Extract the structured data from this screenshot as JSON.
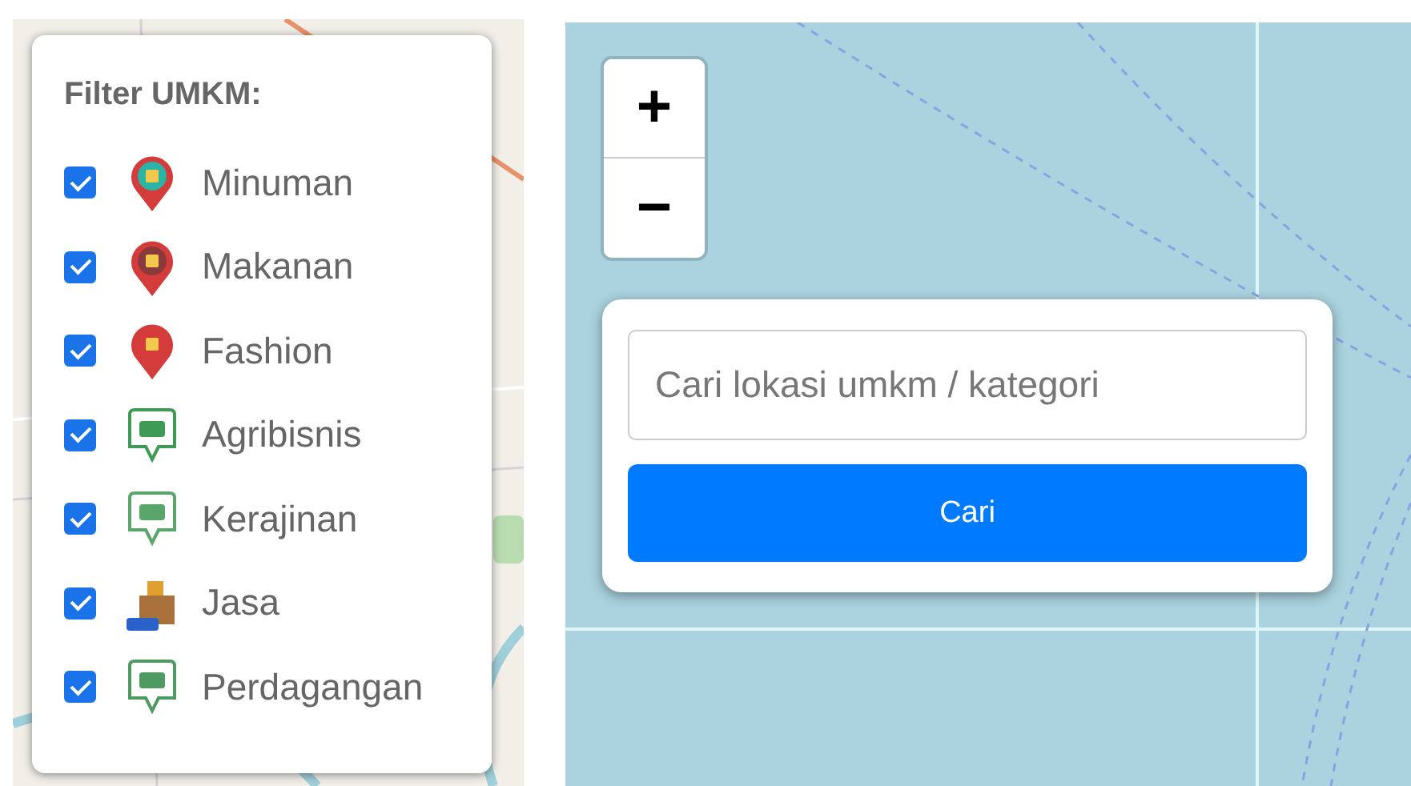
{
  "filter_panel": {
    "title": "Filter UMKM:",
    "items": [
      {
        "label": "Minuman",
        "checked": true,
        "kind": "pin",
        "color": "#2bb3a3"
      },
      {
        "label": "Makanan",
        "checked": true,
        "kind": "pin",
        "color": "#8a3a3a"
      },
      {
        "label": "Fashion",
        "checked": true,
        "kind": "pin",
        "color": "#d63b3b"
      },
      {
        "label": "Agribisnis",
        "checked": true,
        "kind": "tag",
        "color": "#3f9a55"
      },
      {
        "label": "Kerajinan",
        "checked": true,
        "kind": "tag",
        "color": "#5aa66a"
      },
      {
        "label": "Jasa",
        "checked": true,
        "kind": "parcel",
        "color": "#a8703a"
      },
      {
        "label": "Perdagangan",
        "checked": true,
        "kind": "tag",
        "color": "#4f9a63"
      }
    ]
  },
  "zoom_control": {
    "zoom_in": "+",
    "zoom_out": "−"
  },
  "search_panel": {
    "placeholder": "Cari lokasi umkm / kategori",
    "button": "Cari"
  }
}
